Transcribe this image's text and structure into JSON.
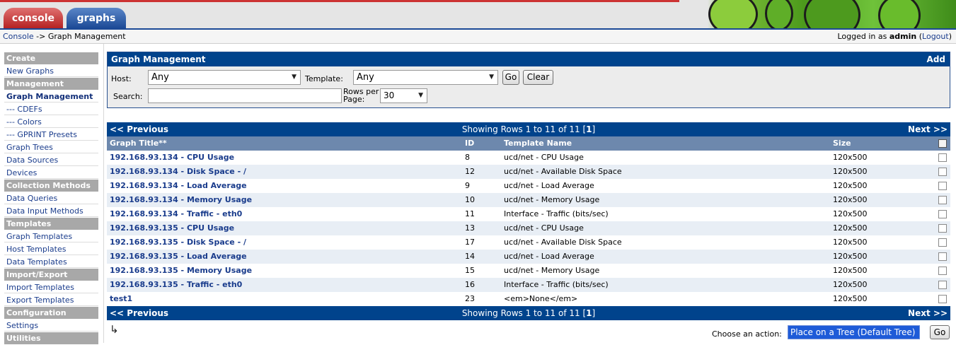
{
  "tabs": {
    "console": "console",
    "graphs": "graphs"
  },
  "breadcrumb": {
    "link": "Console",
    "separator": " -> ",
    "current": "Graph Management"
  },
  "login": {
    "prefix": "Logged in as ",
    "user": "admin",
    "open": " (",
    "logout": "Logout",
    "close": ")"
  },
  "sidebar": {
    "sections": [
      {
        "title": "Create",
        "items": [
          {
            "label": "New Graphs"
          }
        ]
      },
      {
        "title": "Management",
        "items": [
          {
            "label": "Graph Management",
            "active": true
          },
          {
            "label": "--- CDEFs"
          },
          {
            "label": "--- Colors"
          },
          {
            "label": "--- GPRINT Presets"
          },
          {
            "label": "Graph Trees"
          },
          {
            "label": "Data Sources"
          },
          {
            "label": "Devices"
          }
        ]
      },
      {
        "title": "Collection Methods",
        "items": [
          {
            "label": "Data Queries"
          },
          {
            "label": "Data Input Methods"
          }
        ]
      },
      {
        "title": "Templates",
        "items": [
          {
            "label": "Graph Templates"
          },
          {
            "label": "Host Templates"
          },
          {
            "label": "Data Templates"
          }
        ]
      },
      {
        "title": "Import/Export",
        "items": [
          {
            "label": "Import Templates"
          },
          {
            "label": "Export Templates"
          }
        ]
      },
      {
        "title": "Configuration",
        "items": [
          {
            "label": "Settings"
          }
        ]
      },
      {
        "title": "Utilities",
        "items": []
      }
    ]
  },
  "filter": {
    "title": "Graph Management",
    "add": "Add",
    "host_label": "Host:",
    "host_value": "Any",
    "template_label": "Template:",
    "template_value": "Any",
    "go": "Go",
    "clear": "Clear",
    "search_label": "Search:",
    "search_value": "",
    "rows_label": "Rows per Page:",
    "rows_value": "30"
  },
  "pager": {
    "prev": "<< Previous",
    "next": "Next >>",
    "text": "Showing Rows 1 to 11 of 11 [",
    "page": "1",
    "text_end": "]"
  },
  "table": {
    "headers": {
      "title": "Graph Title**",
      "id": "ID",
      "template": "Template Name",
      "size": "Size"
    },
    "rows": [
      {
        "title": "192.168.93.134 - CPU Usage",
        "id": "8",
        "template": "ucd/net - CPU Usage",
        "size": "120x500"
      },
      {
        "title": "192.168.93.134 - Disk Space - /",
        "id": "12",
        "template": "ucd/net - Available Disk Space",
        "size": "120x500"
      },
      {
        "title": "192.168.93.134 - Load Average",
        "id": "9",
        "template": "ucd/net - Load Average",
        "size": "120x500"
      },
      {
        "title": "192.168.93.134 - Memory Usage",
        "id": "10",
        "template": "ucd/net - Memory Usage",
        "size": "120x500"
      },
      {
        "title": "192.168.93.134 - Traffic - eth0",
        "id": "11",
        "template": "Interface - Traffic (bits/sec)",
        "size": "120x500"
      },
      {
        "title": "192.168.93.135 - CPU Usage",
        "id": "13",
        "template": "ucd/net - CPU Usage",
        "size": "120x500"
      },
      {
        "title": "192.168.93.135 - Disk Space - /",
        "id": "17",
        "template": "ucd/net - Available Disk Space",
        "size": "120x500"
      },
      {
        "title": "192.168.93.135 - Load Average",
        "id": "14",
        "template": "ucd/net - Load Average",
        "size": "120x500"
      },
      {
        "title": "192.168.93.135 - Memory Usage",
        "id": "15",
        "template": "ucd/net - Memory Usage",
        "size": "120x500"
      },
      {
        "title": "192.168.93.135 - Traffic - eth0",
        "id": "16",
        "template": "Interface - Traffic (bits/sec)",
        "size": "120x500"
      },
      {
        "title": "test1",
        "id": "23",
        "template": "<em>None</em>",
        "size": "120x500"
      }
    ]
  },
  "actions": {
    "label": "Choose an action:",
    "selected": "Place on a Tree (Default Tree)",
    "go": "Go"
  },
  "colors": {
    "nav_blue": "#00438c",
    "header_blue": "#6d88ad",
    "alt_row": "#e8eef5",
    "sidebar_head": "#a8a8a8",
    "tab_red": "#b52222",
    "tab_blue": "#1c4a96"
  }
}
